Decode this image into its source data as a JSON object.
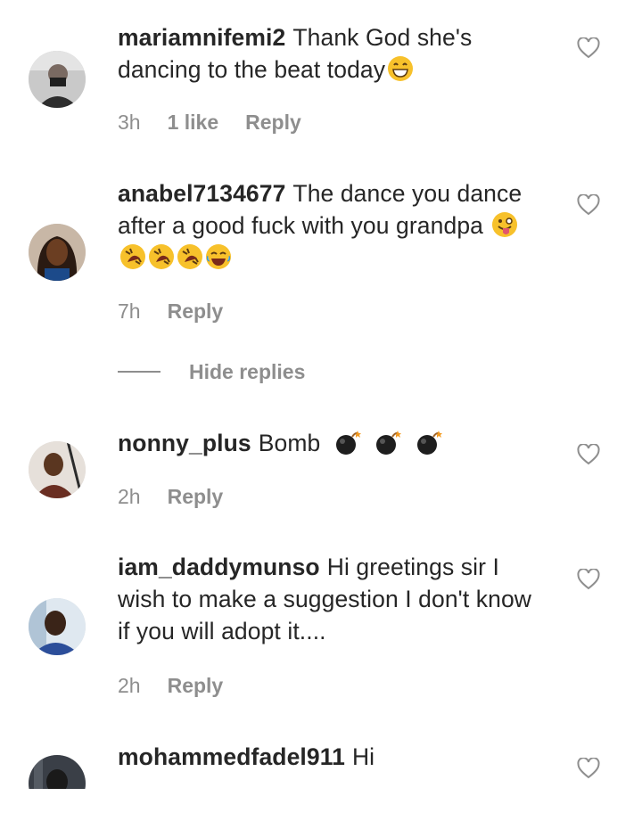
{
  "comments": [
    {
      "username": "mariamnifemi2",
      "text": "Thank God she's dancing to the beat today",
      "emojis": [
        "grinning-face-icon"
      ],
      "time": "3h",
      "likes": "1 like",
      "reply_label": "Reply"
    },
    {
      "username": "anabel7134677",
      "text": "The dance you dance after a good fuck with you grandpa",
      "emojis": [
        "winking-tongue-face-icon",
        "rolling-laughing-icon",
        "rolling-laughing-icon",
        "rolling-laughing-icon",
        "tears-of-joy-icon"
      ],
      "time": "7h",
      "reply_label": "Reply"
    },
    {
      "username": "nonny_plus",
      "text": "Bomb",
      "emojis": [
        "bomb-icon",
        "bomb-icon",
        "bomb-icon"
      ],
      "time": "2h",
      "reply_label": "Reply"
    },
    {
      "username": "iam_daddymunso",
      "text": "Hi greetings sir I wish to make a suggestion I don't know if you will adopt it....",
      "emojis": [],
      "time": "2h",
      "reply_label": "Reply"
    },
    {
      "username": "mohammedfadel911",
      "text": "Hi",
      "emojis": []
    }
  ],
  "hide_replies_label": "Hide replies",
  "icons": {
    "like": "heart-outline-icon"
  },
  "colors": {
    "text": "#262626",
    "meta": "#8e8e8e"
  }
}
